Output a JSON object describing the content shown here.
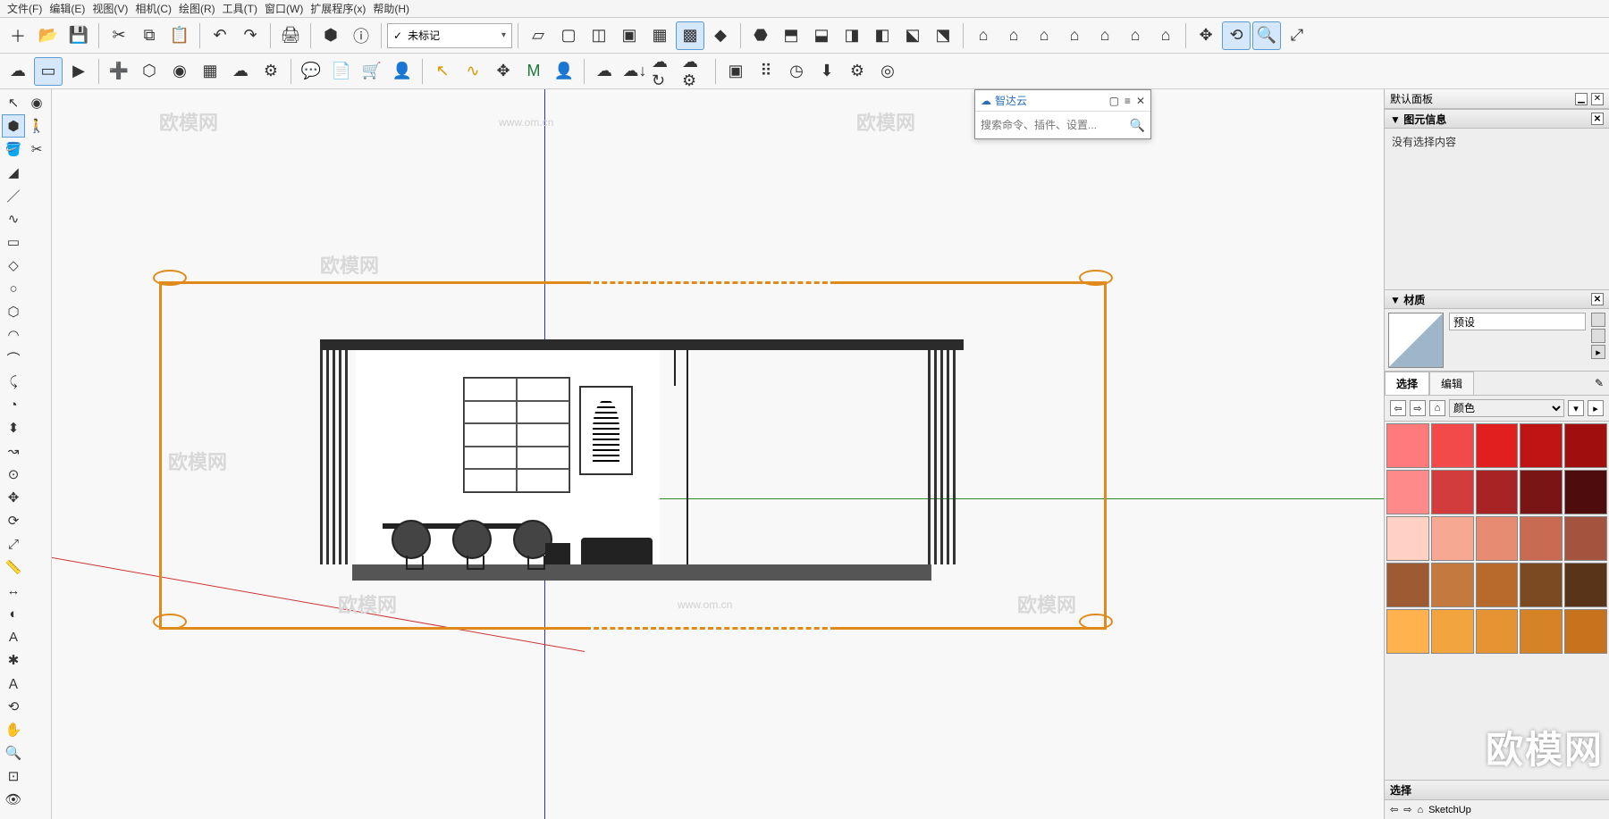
{
  "menus": [
    "文件(F)",
    "编辑(E)",
    "视图(V)",
    "相机(C)",
    "绘图(R)",
    "工具(T)",
    "窗口(W)",
    "扩展程序(x)",
    "帮助(H)"
  ],
  "tag_selector": {
    "checked": "✓",
    "label": "未标记"
  },
  "cloud_panel": {
    "title": "智达云",
    "search_placeholder": "搜索命令、插件、设置..."
  },
  "dock": {
    "default_tray": "默认面板",
    "entity": {
      "title": "▼ 图元信息",
      "empty": "没有选择内容"
    },
    "materials": {
      "title": "▼ 材质",
      "name_value": "预设",
      "tab_select": "选择",
      "tab_edit": "编辑",
      "library": "颜色"
    },
    "select_footer": "选择",
    "status_app": "SketchUp"
  },
  "swatches": [
    "#ff7b7b",
    "#f24a4a",
    "#e21f1f",
    "#c01414",
    "#a00e0e",
    "#ff8a8a",
    "#d23c3c",
    "#a82424",
    "#7a1515",
    "#4f0c0c",
    "#ffd0c4",
    "#f6a893",
    "#e88b73",
    "#c96b52",
    "#a4543e",
    "#9e5a32",
    "#c47a3e",
    "#b86a2d",
    "#7b4a22",
    "#5a3418",
    "#ffb24d",
    "#f2a43f",
    "#e69433",
    "#d68226",
    "#c7721d"
  ],
  "watermark_big": "欧模网",
  "watermark_url": "www.om.cn"
}
